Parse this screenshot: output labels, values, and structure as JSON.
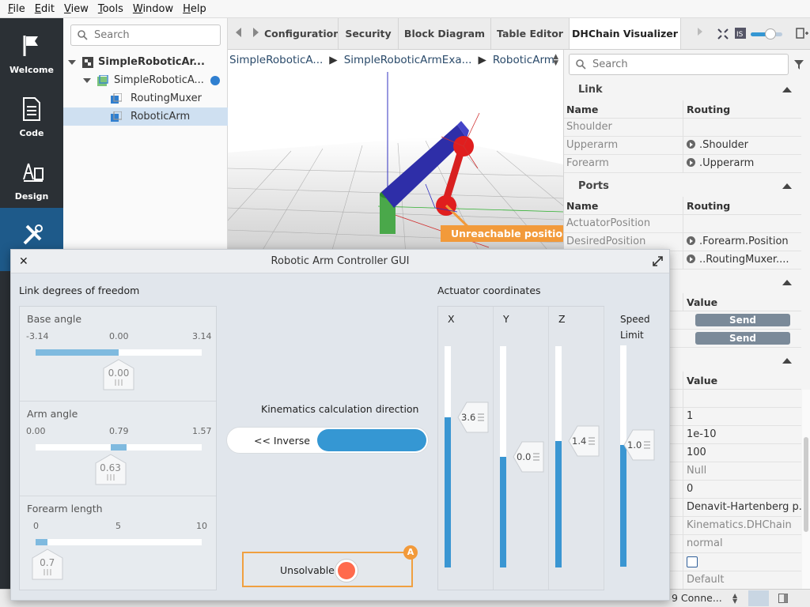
{
  "menu": [
    "File",
    "Edit",
    "View",
    "Tools",
    "Window",
    "Help"
  ],
  "activity": [
    {
      "label": "Welcome",
      "icon": "flag-icon"
    },
    {
      "label": "Code",
      "icon": "document-icon"
    },
    {
      "label": "Design",
      "icon": "design-icon"
    },
    {
      "label": "",
      "icon": "tools-icon"
    }
  ],
  "tree": {
    "search_placeholder": "Search",
    "root": "SimpleRoboticAr...",
    "child": "SimpleRoboticA...",
    "items": [
      "RoutingMuxer",
      "RoboticArm"
    ]
  },
  "tabs": [
    "Configuration",
    "Security",
    "Block Diagram",
    "Table Editor",
    "DHChain Visualizer"
  ],
  "breadcrumb": [
    "SimpleRoboticA...",
    "SimpleRoboticArmExa...",
    "RoboticArm"
  ],
  "viewport": {
    "unreachable": "Unreachable position"
  },
  "props": {
    "search_placeholder": "Search",
    "link": {
      "title": "Link",
      "col_name": "Name",
      "col_routing": "Routing",
      "rows": [
        {
          "name": "Shoulder",
          "routing": ""
        },
        {
          "name": "Upperarm",
          "routing": ".Shoulder"
        },
        {
          "name": "Forearm",
          "routing": ".Upperarm"
        }
      ]
    },
    "ports": {
      "title": "Ports",
      "col_name": "Name",
      "col_routing": "Routing",
      "rows": [
        {
          "name": "ActuatorPosition",
          "routing": ""
        },
        {
          "name": "DesiredPosition",
          "routing": ".Forearm.Position"
        },
        {
          "name": "",
          "routing": "..RoutingMuxer...."
        }
      ]
    },
    "sec3": {
      "col_value": "Value",
      "send": [
        "Send",
        "Send"
      ]
    },
    "sec4": {
      "col_value": "Value",
      "values": [
        "",
        "1",
        "1e-10",
        "100",
        "Null",
        "0",
        "Denavit-Hartenberg p...",
        "Kinematics.DHChain",
        "normal",
        "",
        "Default"
      ]
    }
  },
  "status": {
    "connections": "9 Conne..."
  },
  "dialog": {
    "title": "Robotic Arm Controller GUI",
    "dof_label": "Link degrees of freedom",
    "sliders": [
      {
        "name": "Base angle",
        "min": "-3.14",
        "mid": "0.00",
        "max": "3.14",
        "value": "0.00",
        "frac": 0.5
      },
      {
        "name": "Arm angle",
        "min": "0.00",
        "mid": "0.79",
        "max": "1.57",
        "value": "0.63",
        "frac": 0.45
      },
      {
        "name": "Forearm length",
        "min": "0",
        "mid": "5",
        "max": "10",
        "value": "0.7",
        "frac": 0.07
      }
    ],
    "kinematics_label": "Kinematics calculation direction",
    "toggle_left": "<< Inverse",
    "actuator_label": "Actuator coordinates",
    "axes": [
      {
        "name": "X",
        "value": "3.6",
        "frac": 0.68
      },
      {
        "name": "Y",
        "value": "0.0",
        "frac": 0.5
      },
      {
        "name": "Z",
        "value": "1.4",
        "frac": 0.57
      }
    ],
    "speed_label": [
      "Speed",
      "Limit"
    ],
    "speed": {
      "value": "1.0",
      "frac": 0.55
    },
    "unsolvable": "Unsolvable",
    "badge": "A"
  },
  "colors": {
    "accent": "#3597d3",
    "active_nav": "#1e5a8a",
    "warning": "#f29a3a",
    "led": "#ff6a4c"
  }
}
